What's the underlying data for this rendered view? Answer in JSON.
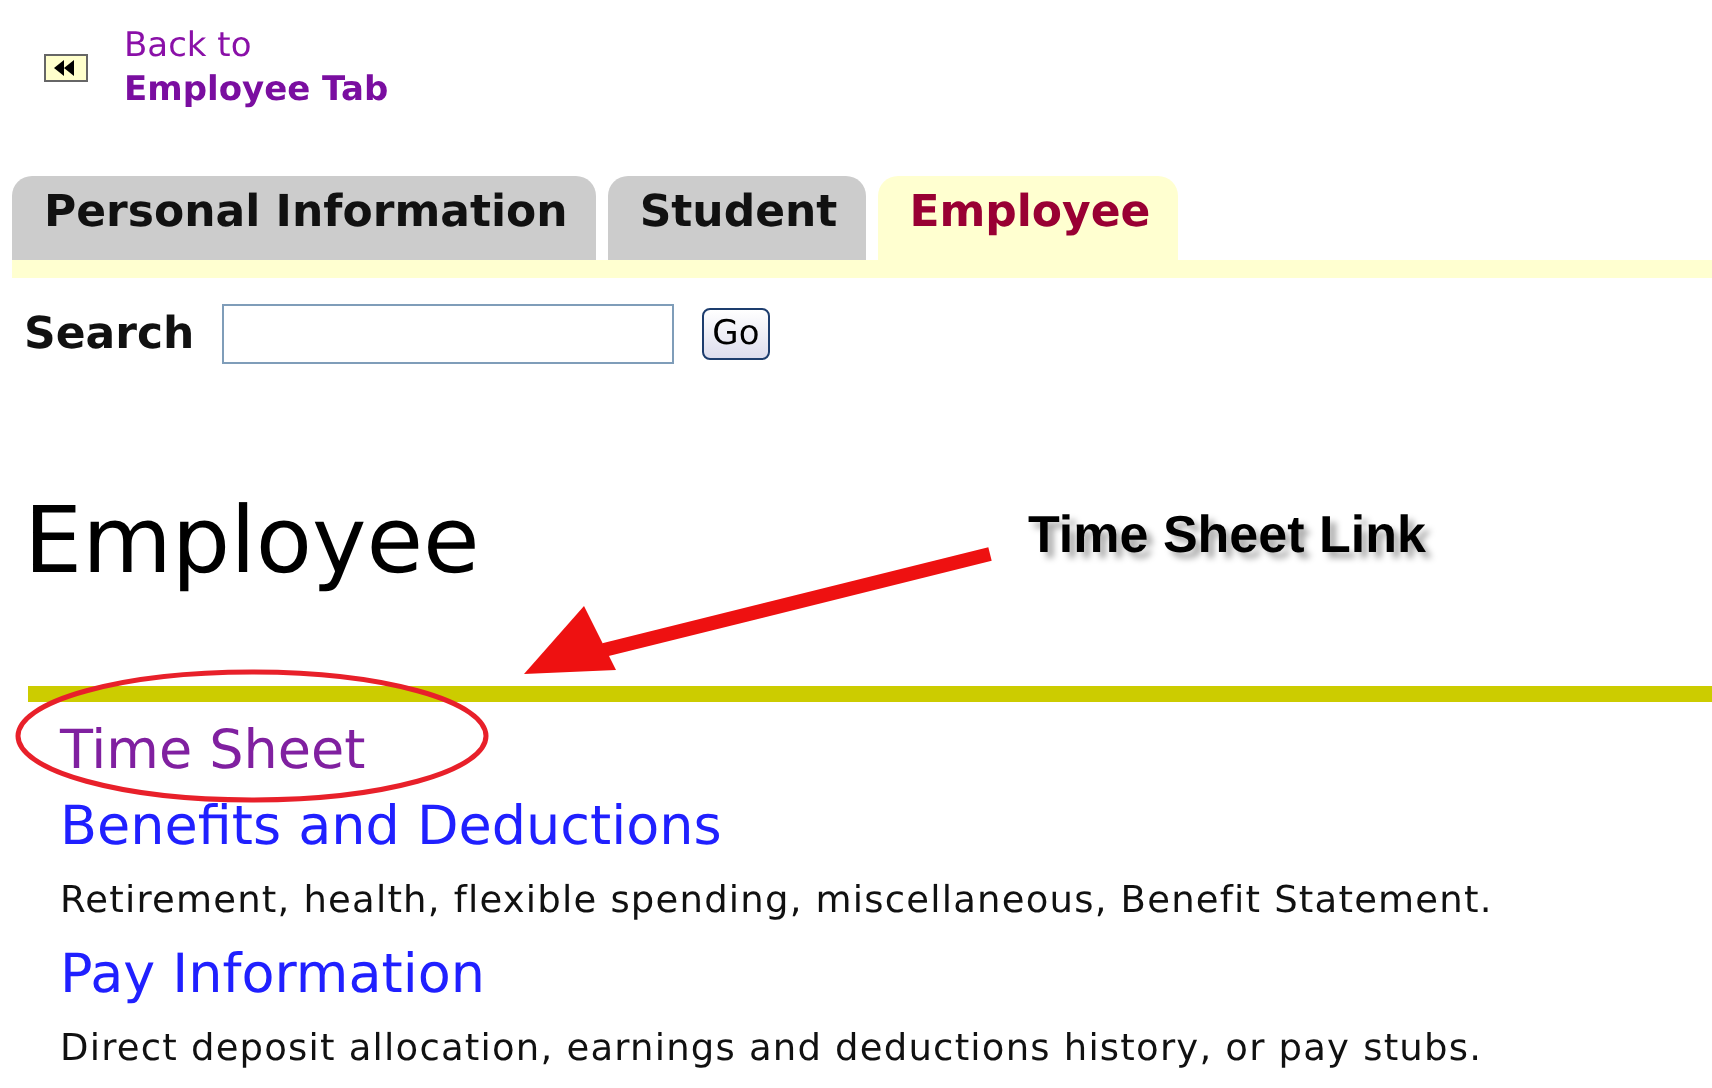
{
  "back_link": {
    "line_1": "Back to",
    "line_2": "Employee Tab"
  },
  "tabs": [
    {
      "label": "Personal Information",
      "selected": false
    },
    {
      "label": "Student",
      "selected": false
    },
    {
      "label": "Employee",
      "selected": true
    }
  ],
  "search": {
    "label": "Search",
    "button": "Go"
  },
  "heading": "Employee",
  "links": [
    {
      "title": "Time Sheet",
      "visited": true
    },
    {
      "title": "Benefits and Deductions",
      "visited": false,
      "description": "Retirement, health, flexible spending, miscellaneous, Benefit Statement."
    },
    {
      "title": "Pay Information",
      "visited": false,
      "description": "Direct deposit allocation, earnings and deductions history, or pay stubs."
    }
  ],
  "annotation": {
    "callout": "Time Sheet Link"
  }
}
